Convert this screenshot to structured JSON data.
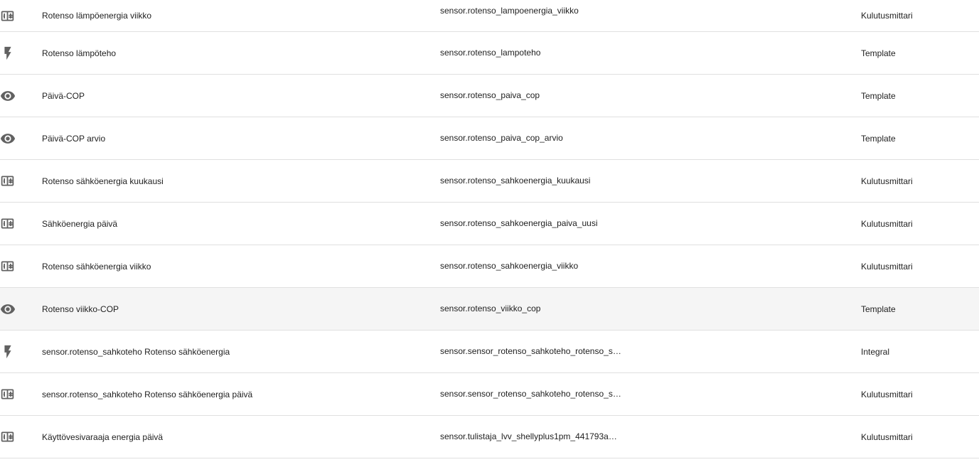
{
  "rows": [
    {
      "icon": "counter-icon",
      "name": "Rotenso lämpöenergia viikko",
      "entity": "sensor.rotenso_lampoenergia_viikko",
      "integration": "Kulutusmittari"
    },
    {
      "icon": "flash-icon",
      "name": "Rotenso lämpöteho",
      "entity": "sensor.rotenso_lampoteho",
      "integration": "Template"
    },
    {
      "icon": "eye-icon",
      "name": "Päivä-COP",
      "entity": "sensor.rotenso_paiva_cop",
      "integration": "Template"
    },
    {
      "icon": "eye-icon",
      "name": "Päivä-COP arvio",
      "entity": "sensor.rotenso_paiva_cop_arvio",
      "integration": "Template"
    },
    {
      "icon": "counter-icon",
      "name": "Rotenso sähköenergia kuukausi",
      "entity": "sensor.rotenso_sahkoenergia_kuukausi",
      "integration": "Kulutusmittari"
    },
    {
      "icon": "counter-icon",
      "name": "Sähköenergia päivä",
      "entity": "sensor.rotenso_sahkoenergia_paiva_uusi",
      "integration": "Kulutusmittari"
    },
    {
      "icon": "counter-icon",
      "name": "Rotenso sähköenergia viikko",
      "entity": "sensor.rotenso_sahkoenergia_viikko",
      "integration": "Kulutusmittari"
    },
    {
      "icon": "eye-icon",
      "name": "Rotenso viikko-COP",
      "entity": "sensor.rotenso_viikko_cop",
      "integration": "Template",
      "highlighted": true
    },
    {
      "icon": "flash-outline-icon",
      "name": "sensor.rotenso_sahkoteho Rotenso sähköenergia",
      "entity": "sensor.sensor_rotenso_sahkoteho_rotenso_s…",
      "integration": "Integral"
    },
    {
      "icon": "counter-icon",
      "name": "sensor.rotenso_sahkoteho Rotenso sähköenergia päivä",
      "entity": "sensor.sensor_rotenso_sahkoteho_rotenso_s…",
      "integration": "Kulutusmittari"
    },
    {
      "icon": "counter-icon",
      "name": "Käyttövesivaraaja energia päivä",
      "entity": "sensor.tulistaja_lvv_shellyplus1pm_441793a…",
      "integration": "Kulutusmittari"
    }
  ],
  "colors": {
    "icon": "#616161",
    "text": "#212121",
    "divider": "#e0e0e0",
    "highlight": "#f5f5f5"
  }
}
